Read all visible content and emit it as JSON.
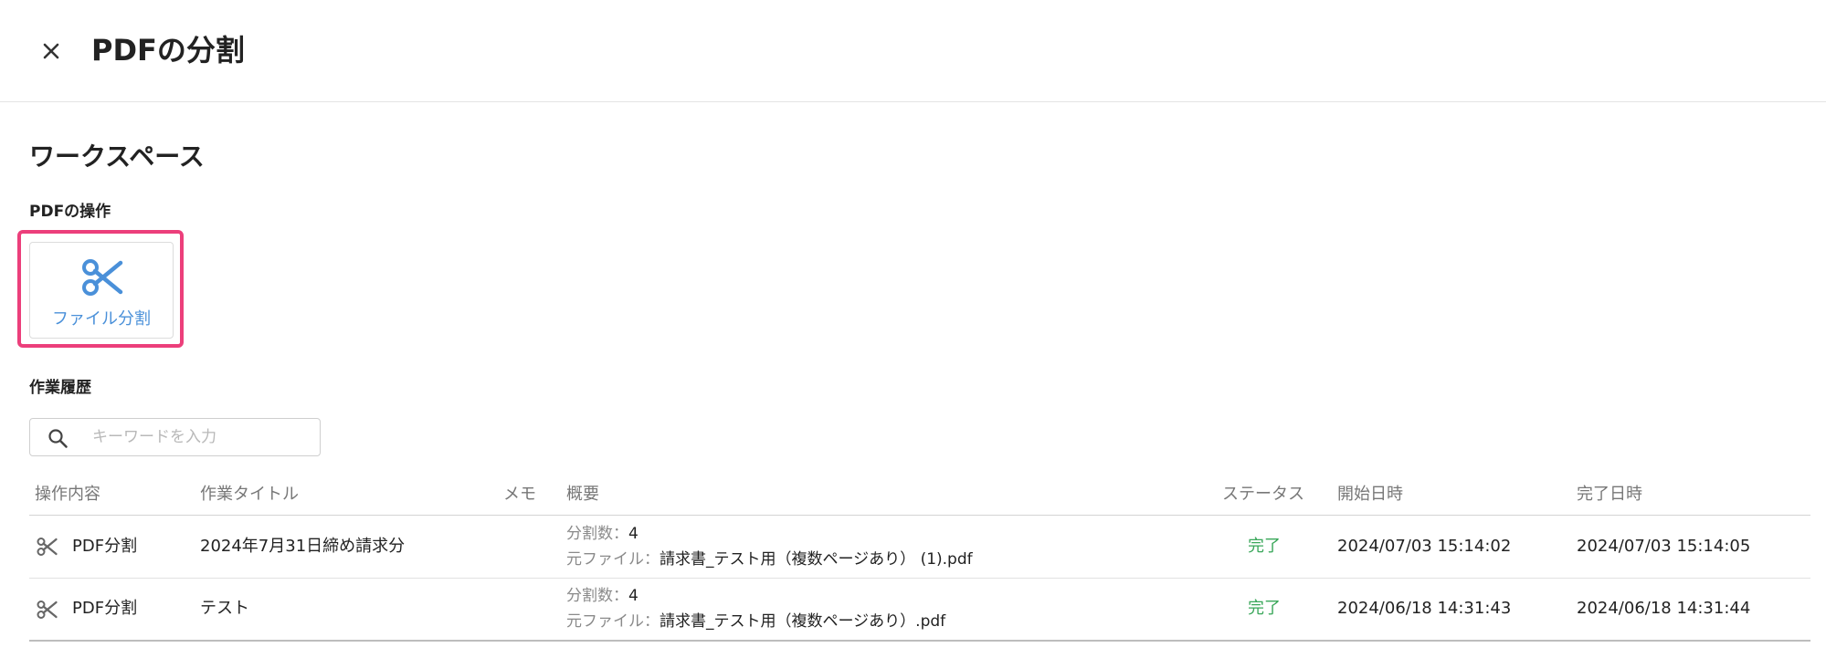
{
  "header": {
    "close_icon": "close-icon",
    "title": "PDFの分割"
  },
  "workspace": {
    "title": "ワークスペース",
    "operations_label": "PDFの操作",
    "operations": [
      {
        "label": "ファイル分割",
        "icon": "scissors-icon",
        "color": "#4a90d9",
        "highlighted": true
      }
    ]
  },
  "history": {
    "label": "作業履歴",
    "search": {
      "placeholder": "キーワードを入力",
      "value": "",
      "icon": "search-icon"
    },
    "columns": {
      "operation": "操作内容",
      "title": "作業タイトル",
      "memo": "メモ",
      "summary": "概要",
      "status": "ステータス",
      "start": "開始日時",
      "end": "完了日時"
    },
    "rows": [
      {
        "operation": "PDF分割",
        "title": "2024年7月31日締め請求分",
        "memo": "",
        "summary_count_label": "分割数：",
        "summary_count": "4",
        "summary_file_label": "元ファイル：",
        "summary_file": "請求書_テスト用（複数ページあり） (1).pdf",
        "status": "完了",
        "start": "2024/07/03 15:14:02",
        "end": "2024/07/03 15:14:05"
      },
      {
        "operation": "PDF分割",
        "title": "テスト",
        "memo": "",
        "summary_count_label": "分割数：",
        "summary_count": "4",
        "summary_file_label": "元ファイル：",
        "summary_file": "請求書_テスト用（複数ページあり）.pdf",
        "status": "完了",
        "start": "2024/06/18 14:31:43",
        "end": "2024/06/18 14:31:44"
      }
    ]
  },
  "colors": {
    "accent": "#4a90d9",
    "highlight": "#ec3f7b",
    "status_done": "#3aa75a"
  }
}
